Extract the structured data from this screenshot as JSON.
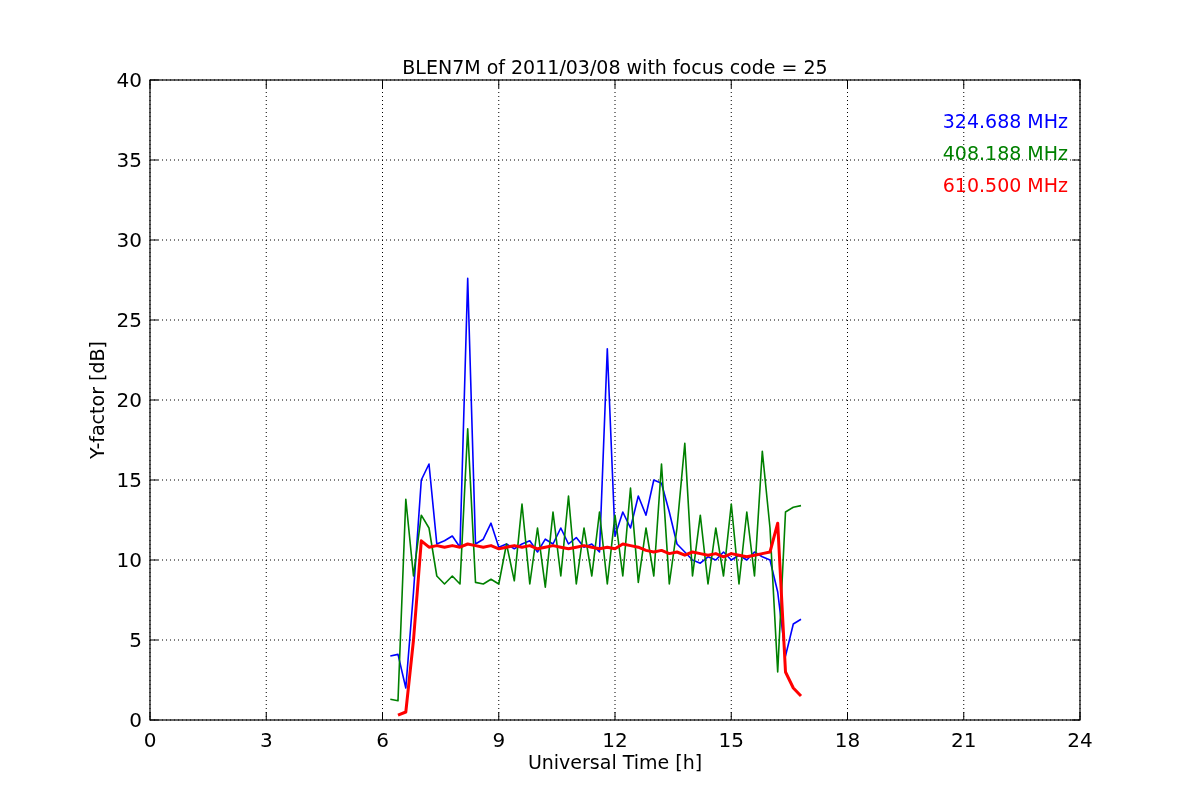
{
  "chart": {
    "chart_data": {
      "type": "line",
      "title": "BLEN7M of 2011/03/08 with focus code = 25",
      "xlabel": "Universal Time [h]",
      "ylabel": "Y-factor [dB]",
      "x": [
        6.2,
        6.4,
        6.6,
        6.8,
        7.0,
        7.2,
        7.4,
        7.6,
        7.8,
        8.0,
        8.2,
        8.4,
        8.6,
        8.8,
        9.0,
        9.2,
        9.4,
        9.6,
        9.8,
        10.0,
        10.2,
        10.4,
        10.6,
        10.8,
        11.0,
        11.2,
        11.4,
        11.6,
        11.8,
        12.0,
        12.2,
        12.4,
        12.6,
        12.8,
        13.0,
        13.2,
        13.4,
        13.6,
        13.8,
        14.0,
        14.2,
        14.4,
        14.6,
        14.8,
        15.0,
        15.2,
        15.4,
        15.6,
        15.8,
        16.0,
        16.2,
        16.4,
        16.6,
        16.8
      ],
      "series": [
        {
          "name": "324.688 MHz",
          "color": "#0000ff",
          "values": [
            4,
            4.1,
            2,
            8,
            15,
            16,
            11,
            11.2,
            11.5,
            10.8,
            27.6,
            11,
            11.3,
            12.3,
            10.8,
            11,
            10.7,
            11,
            11.2,
            10.5,
            11.3,
            11,
            12,
            11,
            11.4,
            10.8,
            11,
            10.5,
            23.2,
            11.5,
            13,
            12,
            14,
            12.8,
            15,
            14.8,
            13,
            11,
            10.5,
            10,
            9.8,
            10.2,
            10,
            10.5,
            10,
            10.3,
            10,
            10.5,
            10.2,
            10,
            8,
            4,
            6,
            6.3
          ]
        },
        {
          "name": "408.188 MHz",
          "color": "#008000",
          "values": [
            1.3,
            1.2,
            13.8,
            9,
            12.8,
            12,
            9,
            8.5,
            9,
            8.5,
            18.2,
            8.6,
            8.5,
            8.8,
            8.5,
            11,
            8.7,
            13.5,
            8.5,
            12,
            8.3,
            13,
            9,
            14,
            8.5,
            12,
            9,
            13,
            8.5,
            12.8,
            9,
            14.5,
            8.6,
            12,
            9,
            16,
            8.5,
            12,
            17.3,
            9,
            12.8,
            8.5,
            12,
            9,
            13.5,
            8.5,
            13,
            9,
            16.8,
            12,
            3,
            13,
            13.3,
            13.4
          ]
        },
        {
          "name": "610.500 MHz",
          "color": "#ff0000",
          "values": [
            null,
            0.3,
            0.5,
            5,
            11.2,
            10.8,
            10.9,
            10.8,
            10.9,
            10.8,
            11,
            10.9,
            10.8,
            10.9,
            10.7,
            10.8,
            10.9,
            10.8,
            10.9,
            10.7,
            10.8,
            10.9,
            10.8,
            10.7,
            10.8,
            10.9,
            10.8,
            10.7,
            10.8,
            10.7,
            11,
            10.9,
            10.8,
            10.6,
            10.5,
            10.6,
            10.4,
            10.5,
            10.3,
            10.5,
            10.4,
            10.3,
            10.4,
            10.2,
            10.4,
            10.3,
            10.2,
            10.3,
            10.4,
            10.5,
            12.3,
            3,
            2,
            1.5
          ]
        }
      ],
      "grid": true,
      "xlim": [
        0,
        24
      ],
      "ylim": [
        0,
        40
      ],
      "xticks": [
        0,
        3,
        6,
        9,
        12,
        15,
        18,
        21,
        24
      ],
      "yticks": [
        0,
        5,
        10,
        15,
        20,
        25,
        30,
        35,
        40
      ]
    }
  }
}
